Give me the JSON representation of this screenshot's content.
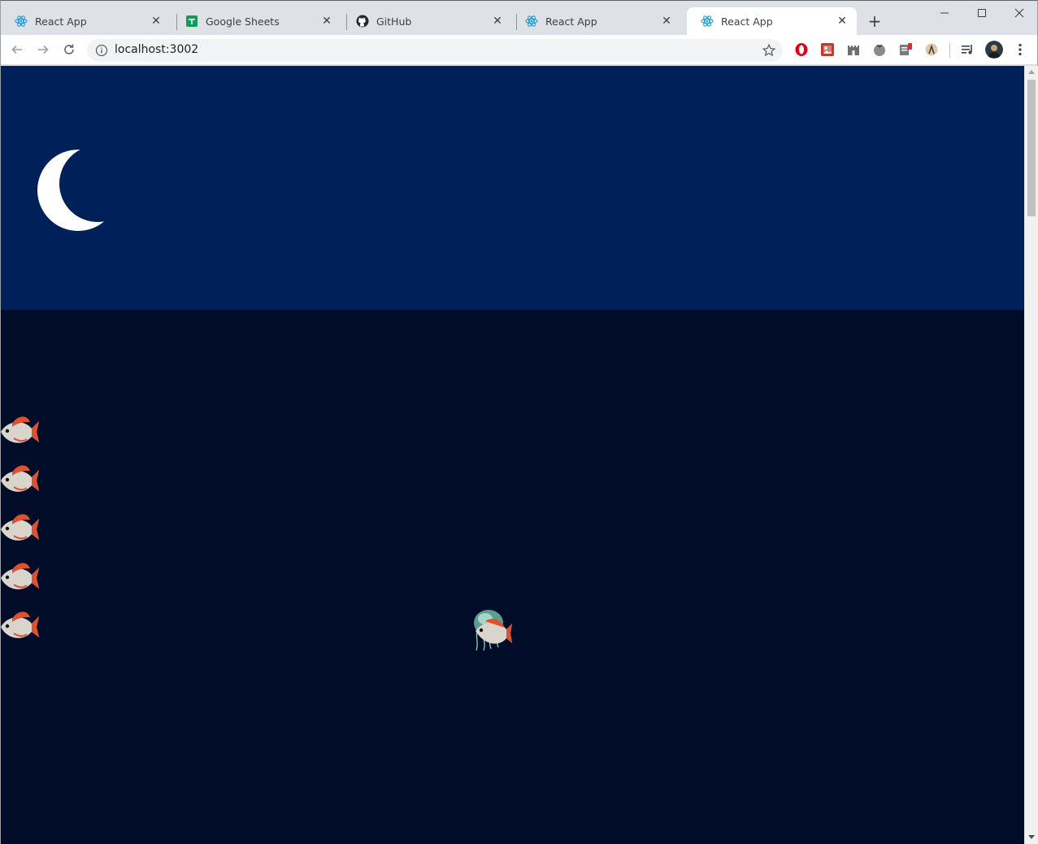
{
  "browser": {
    "tabs": [
      {
        "title": "React App",
        "favicon": "react-icon",
        "active": false
      },
      {
        "title": "Google Sheets",
        "favicon": "sheets-icon",
        "active": false
      },
      {
        "title": "GitHub",
        "favicon": "github-icon",
        "active": false
      },
      {
        "title": "React App",
        "favicon": "react-icon",
        "active": false
      },
      {
        "title": "React App",
        "favicon": "react-icon",
        "active": true
      }
    ],
    "address": "localhost:3002",
    "extensions": [
      "opera-icon",
      "image-extension-icon",
      "castle-extension-icon",
      "tomato-extension-icon",
      "clipboard-extension-icon",
      "user-extension-icon"
    ]
  },
  "colors": {
    "sky": "#00205a",
    "sea": "#000c28",
    "moon": "#ffffff",
    "fish_body": "#d9d4cc",
    "fish_accent": "#e0502d"
  },
  "scene": {
    "moon_icon": "crescent-moon-icon",
    "player_icon": "fish-jellyfish-player",
    "fish_count": 5,
    "fish_icon": "fish-icon"
  }
}
